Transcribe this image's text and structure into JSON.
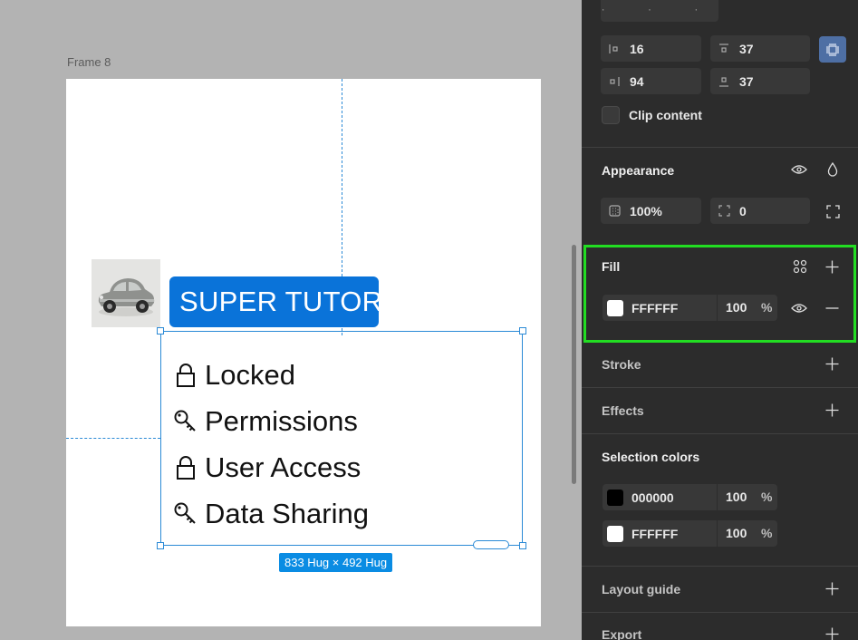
{
  "canvas": {
    "frame_label": "Frame 8",
    "badge_text": "SUPER TUTOR",
    "permissions": [
      {
        "icon": "lock-icon",
        "label": "Locked"
      },
      {
        "icon": "key-icon",
        "label": "Permissions"
      },
      {
        "icon": "lock-icon",
        "label": "User Access"
      },
      {
        "icon": "key-icon",
        "label": "Data Sharing"
      }
    ],
    "size_tag": "833 Hug × 492 Hug"
  },
  "panel": {
    "top_stub": "· · ·",
    "padding": {
      "left": "16",
      "top": "37",
      "right": "94",
      "bottom": "37"
    },
    "clip_content_label": "Clip content",
    "appearance": {
      "title": "Appearance",
      "opacity": "100%",
      "corner_radius": "0"
    },
    "fill": {
      "title": "Fill",
      "color_hex": "FFFFFF",
      "opacity": "100",
      "percent": "%",
      "swatch_color": "#FFFFFF"
    },
    "stroke_title": "Stroke",
    "effects_title": "Effects",
    "selection_colors": {
      "title": "Selection colors",
      "items": [
        {
          "hex": "000000",
          "opacity": "100",
          "percent": "%",
          "swatch": "#000000"
        },
        {
          "hex": "FFFFFF",
          "opacity": "100",
          "percent": "%",
          "swatch": "#FFFFFF"
        }
      ]
    },
    "layout_guide_title": "Layout guide",
    "export_title": "Export"
  },
  "colors": {
    "canvas_bg": "#B3B3B3",
    "panel_bg": "#2C2C2C",
    "selection_blue": "#2B8AD6",
    "badge_blue": "#0A73D9",
    "highlight_green": "#22DD22"
  }
}
